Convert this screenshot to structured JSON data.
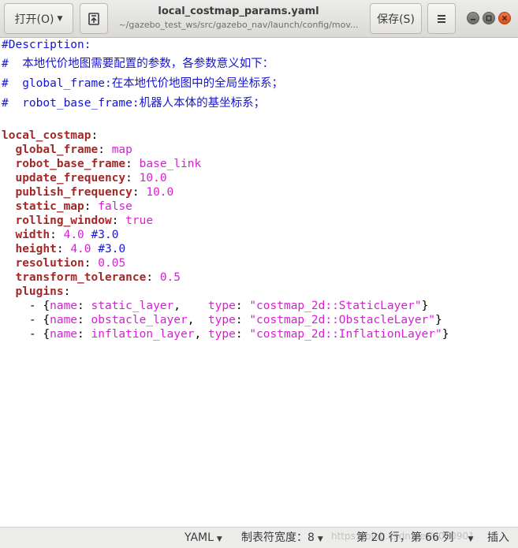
{
  "header": {
    "open_label": "打开(O)",
    "save_label": "保存(S)",
    "title": "local_costmap_params.yaml",
    "subtitle": "~/gazebo_test_ws/src/gazebo_nav/launch/config/mov..."
  },
  "editor": {
    "lines": [
      [
        {
          "t": "cm",
          "v": "#Description:"
        }
      ],
      [
        {
          "t": "cm",
          "v": "#  "
        },
        {
          "t": "cmcjk",
          "v": "本地代价地图需要配置的参数，各参数意义如下："
        }
      ],
      [
        {
          "t": "cm",
          "v": "#  global_frame:"
        },
        {
          "t": "cmcjk",
          "v": "在本地代价地图中的全局坐标系；"
        }
      ],
      [
        {
          "t": "cm",
          "v": "#  robot_base_frame:"
        },
        {
          "t": "cmcjk",
          "v": "机器人本体的基坐标系；"
        }
      ],
      [],
      [
        {
          "t": "key",
          "v": "local_costmap"
        },
        {
          "t": "punct",
          "v": ":"
        }
      ],
      [
        {
          "t": "sp",
          "v": "  "
        },
        {
          "t": "key",
          "v": "global_frame"
        },
        {
          "t": "punct",
          "v": ": "
        },
        {
          "t": "val",
          "v": "map"
        }
      ],
      [
        {
          "t": "sp",
          "v": "  "
        },
        {
          "t": "key",
          "v": "robot_base_frame"
        },
        {
          "t": "punct",
          "v": ": "
        },
        {
          "t": "val",
          "v": "base_link"
        }
      ],
      [
        {
          "t": "sp",
          "v": "  "
        },
        {
          "t": "key",
          "v": "update_frequency"
        },
        {
          "t": "punct",
          "v": ": "
        },
        {
          "t": "val",
          "v": "10.0"
        }
      ],
      [
        {
          "t": "sp",
          "v": "  "
        },
        {
          "t": "key",
          "v": "publish_frequency"
        },
        {
          "t": "punct",
          "v": ": "
        },
        {
          "t": "val",
          "v": "10.0"
        }
      ],
      [
        {
          "t": "sp",
          "v": "  "
        },
        {
          "t": "key",
          "v": "static_map"
        },
        {
          "t": "punct",
          "v": ": "
        },
        {
          "t": "val",
          "v": "false"
        }
      ],
      [
        {
          "t": "sp",
          "v": "  "
        },
        {
          "t": "key",
          "v": "rolling_window"
        },
        {
          "t": "punct",
          "v": ": "
        },
        {
          "t": "val",
          "v": "true"
        }
      ],
      [
        {
          "t": "sp",
          "v": "  "
        },
        {
          "t": "key",
          "v": "width"
        },
        {
          "t": "punct",
          "v": ": "
        },
        {
          "t": "val",
          "v": "4.0"
        },
        {
          "t": "inline",
          "v": " #3.0"
        }
      ],
      [
        {
          "t": "sp",
          "v": "  "
        },
        {
          "t": "key",
          "v": "height"
        },
        {
          "t": "punct",
          "v": ": "
        },
        {
          "t": "val",
          "v": "4.0"
        },
        {
          "t": "inline",
          "v": " #3.0"
        }
      ],
      [
        {
          "t": "sp",
          "v": "  "
        },
        {
          "t": "key",
          "v": "resolution"
        },
        {
          "t": "punct",
          "v": ": "
        },
        {
          "t": "val",
          "v": "0.05"
        }
      ],
      [
        {
          "t": "sp",
          "v": "  "
        },
        {
          "t": "key",
          "v": "transform_tolerance"
        },
        {
          "t": "punct",
          "v": ": "
        },
        {
          "t": "val",
          "v": "0.5"
        }
      ],
      [
        {
          "t": "sp",
          "v": "  "
        },
        {
          "t": "key",
          "v": "plugins"
        },
        {
          "t": "punct",
          "v": ":"
        }
      ],
      [
        {
          "t": "punct",
          "v": "    - {"
        },
        {
          "t": "val",
          "v": "name"
        },
        {
          "t": "punct",
          "v": ": "
        },
        {
          "t": "val",
          "v": "static_layer"
        },
        {
          "t": "punct",
          "v": ",    "
        },
        {
          "t": "val",
          "v": "type"
        },
        {
          "t": "punct",
          "v": ": "
        },
        {
          "t": "str",
          "v": "\"costmap_2d::StaticLayer\""
        },
        {
          "t": "punct",
          "v": "}"
        }
      ],
      [
        {
          "t": "punct",
          "v": "    - {"
        },
        {
          "t": "val",
          "v": "name"
        },
        {
          "t": "punct",
          "v": ": "
        },
        {
          "t": "val",
          "v": "obstacle_layer"
        },
        {
          "t": "punct",
          "v": ",  "
        },
        {
          "t": "val",
          "v": "type"
        },
        {
          "t": "punct",
          "v": ": "
        },
        {
          "t": "str",
          "v": "\"costmap_2d::ObstacleLayer\""
        },
        {
          "t": "punct",
          "v": "}"
        }
      ],
      [
        {
          "t": "punct",
          "v": "    - {"
        },
        {
          "t": "val",
          "v": "name"
        },
        {
          "t": "punct",
          "v": ": "
        },
        {
          "t": "val",
          "v": "inflation_layer"
        },
        {
          "t": "punct",
          "v": ", "
        },
        {
          "t": "val",
          "v": "type"
        },
        {
          "t": "punct",
          "v": ": "
        },
        {
          "t": "str",
          "v": "\"costmap_2d::InflationLayer\""
        },
        {
          "t": "punct",
          "v": "}"
        }
      ]
    ]
  },
  "statusbar": {
    "language": "YAML",
    "tab_width": "制表符宽度：8",
    "position": "第 20 行，第 66 列",
    "mode": "插入",
    "watermark": "https://blog.csdn.net/u010901"
  },
  "colors": {
    "comment": "#1515d0",
    "key": "#a42828",
    "value": "#d51fd5",
    "close_button": "#df4b16"
  },
  "icons": [
    "dropdown-caret-icon",
    "pin-document-icon",
    "hamburger-menu-icon",
    "minimize-icon",
    "maximize-icon",
    "close-icon"
  ]
}
